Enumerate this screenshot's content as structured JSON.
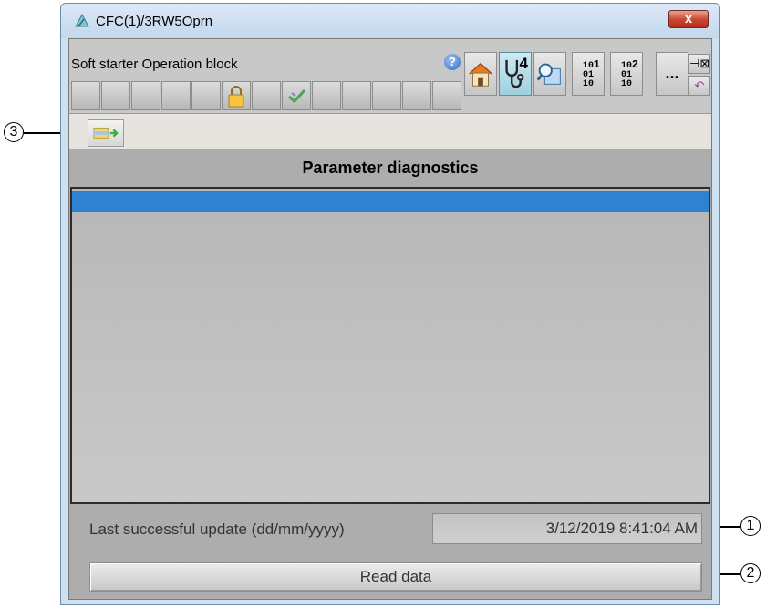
{
  "window": {
    "title": "CFC(1)/3RW5Oprn",
    "close_label": "x"
  },
  "toolbar": {
    "block_title": "Soft starter Operation block",
    "help_label": "?",
    "diagnostics_badge": "4",
    "binary1": {
      "top": "10",
      "sup": "1",
      "mid": "01",
      "bot": "10"
    },
    "binary2": {
      "top": "10",
      "sup": "2",
      "mid": "01",
      "bot": "10"
    },
    "more_label": "...",
    "pin_label": "⊣⊠",
    "back_label": "↶"
  },
  "panel": {
    "header": "Parameter diagnostics"
  },
  "footer": {
    "update_label": "Last successful update (dd/mm/yyyy)",
    "update_value": "3/12/2019  8:41:04 AM",
    "read_button": "Read data"
  },
  "callouts": {
    "c1": "1",
    "c2": "2",
    "c3": "3"
  },
  "colors": {
    "selection": "#2f82cf",
    "panel_bg": "#adadad",
    "titlebar": "#cfe0f1",
    "close": "#c8452e"
  },
  "icons": [
    "app-logo-icon",
    "help-icon",
    "home-icon",
    "stethoscope-icon",
    "trend-magnifier-icon",
    "lock-icon",
    "checkmark-icon",
    "navigate-icon"
  ]
}
